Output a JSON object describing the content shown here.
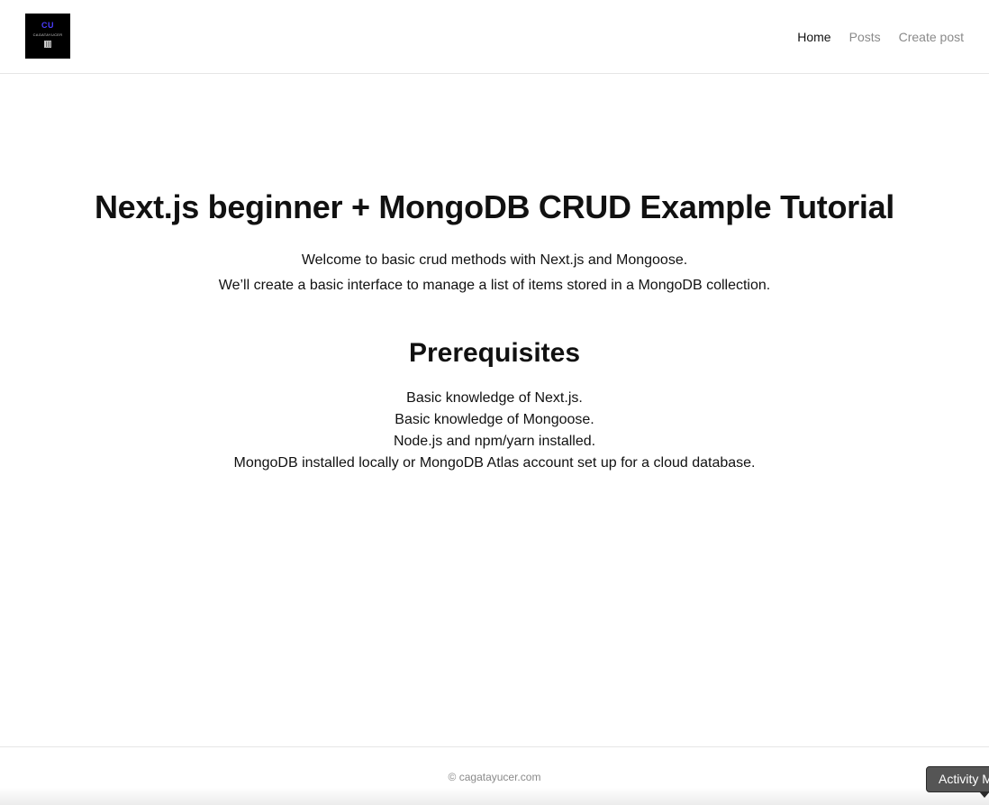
{
  "header": {
    "logo": {
      "mark_text": "CU",
      "name_text": "CAGATAYUCER",
      "mark_color": "#4b3cff"
    },
    "nav": [
      {
        "label": "Home",
        "active": true
      },
      {
        "label": "Posts",
        "active": false
      },
      {
        "label": "Create post",
        "active": false
      }
    ]
  },
  "main": {
    "title": "Next.js beginner + MongoDB CRUD Example Tutorial",
    "intro": [
      "Welcome to basic crud methods with Next.js and Mongoose.",
      "We’ll create a basic interface to manage a list of items stored in a MongoDB collection."
    ],
    "prerequisites_heading": "Prerequisites",
    "prerequisites": [
      "Basic knowledge of Next.js.",
      "Basic knowledge of Mongoose.",
      "Node.js and npm/yarn installed.",
      "MongoDB installed locally or MongoDB Atlas account set up for a cloud database."
    ]
  },
  "footer": {
    "copyright": "© cagatayucer.com",
    "activity_button": "Activity M"
  },
  "colors": {
    "text_primary": "#111111",
    "text_muted": "#8a8a8a",
    "border": "#e6e6e6"
  }
}
